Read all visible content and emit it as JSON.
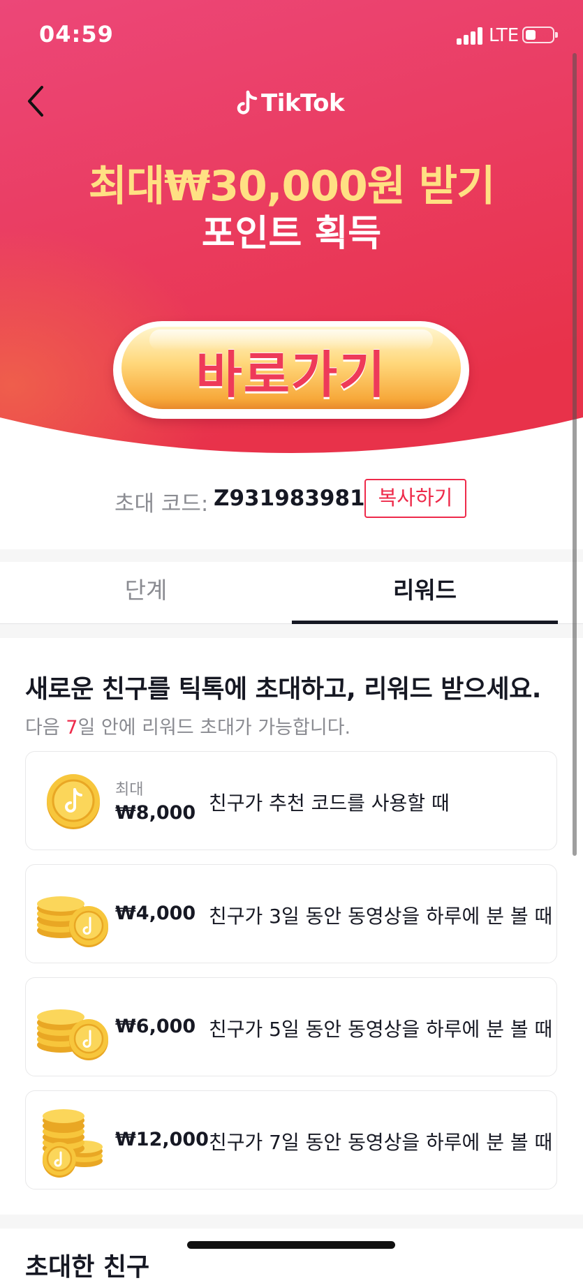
{
  "status_bar": {
    "time": "04:59",
    "network": "LTE"
  },
  "header": {
    "brand": "TikTok"
  },
  "hero": {
    "headline": "최대₩30,000원 받기",
    "subhead": "포인트 획득",
    "cta_label": "바로가기"
  },
  "invite": {
    "label": "초대 코드:",
    "code": "Z931983981",
    "copy_label": "복사하기"
  },
  "tabs": [
    {
      "label": "단계",
      "active": false
    },
    {
      "label": "리워드",
      "active": true
    }
  ],
  "rewards": {
    "title": "새로운 친구를 틱톡에 초대하고, 리워드 받으세요.",
    "subtitle_prefix": "다음 ",
    "subtitle_days": "7",
    "subtitle_suffix": "일 안에 리워드 초대가 가능합니다.",
    "items": [
      {
        "max_label": "최대",
        "amount": "₩8,000",
        "description": "친구가 추천 코드를 사용할 때",
        "icon": "single-coin-icon"
      },
      {
        "amount": "₩4,000",
        "description": "친구가 3일 동안 동영상을 하루에 분 볼 때",
        "icon": "coin-stack-small-icon"
      },
      {
        "amount": "₩6,000",
        "description": "친구가 5일 동안 동영상을 하루에 분 볼 때",
        "icon": "coin-stack-medium-icon"
      },
      {
        "amount": "₩12,000",
        "description": "친구가 7일 동안 동영상을 하루에 분 볼 때",
        "icon": "coin-stack-large-icon"
      }
    ]
  },
  "invited_friends": {
    "heading": "초대한 친구"
  },
  "colors": {
    "brand_gradient_start": "#ec4470",
    "brand_gradient_end": "#e8334a",
    "headline_yellow": "#ffe083",
    "accent_red": "#ee2a4a",
    "coin_gold": "#f5c43a"
  }
}
